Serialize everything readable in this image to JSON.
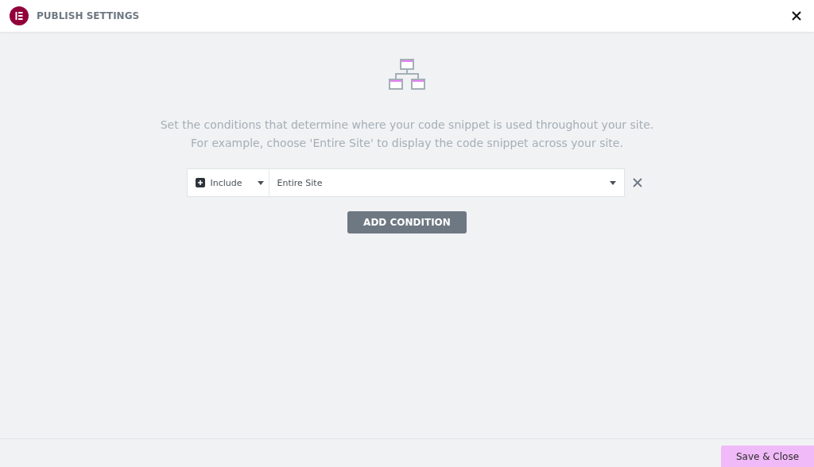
{
  "header": {
    "title": "PUBLISH SETTINGS"
  },
  "intro": [
    "Set the conditions that determine where your code snippet is used throughout your site.",
    "For example, choose 'Entire Site' to display the code snippet across your site."
  ],
  "conditions": [
    {
      "type": "Include",
      "value": "Entire Site"
    }
  ],
  "add_button": "ADD CONDITION",
  "footer": {
    "save_button": "Save & Close"
  }
}
